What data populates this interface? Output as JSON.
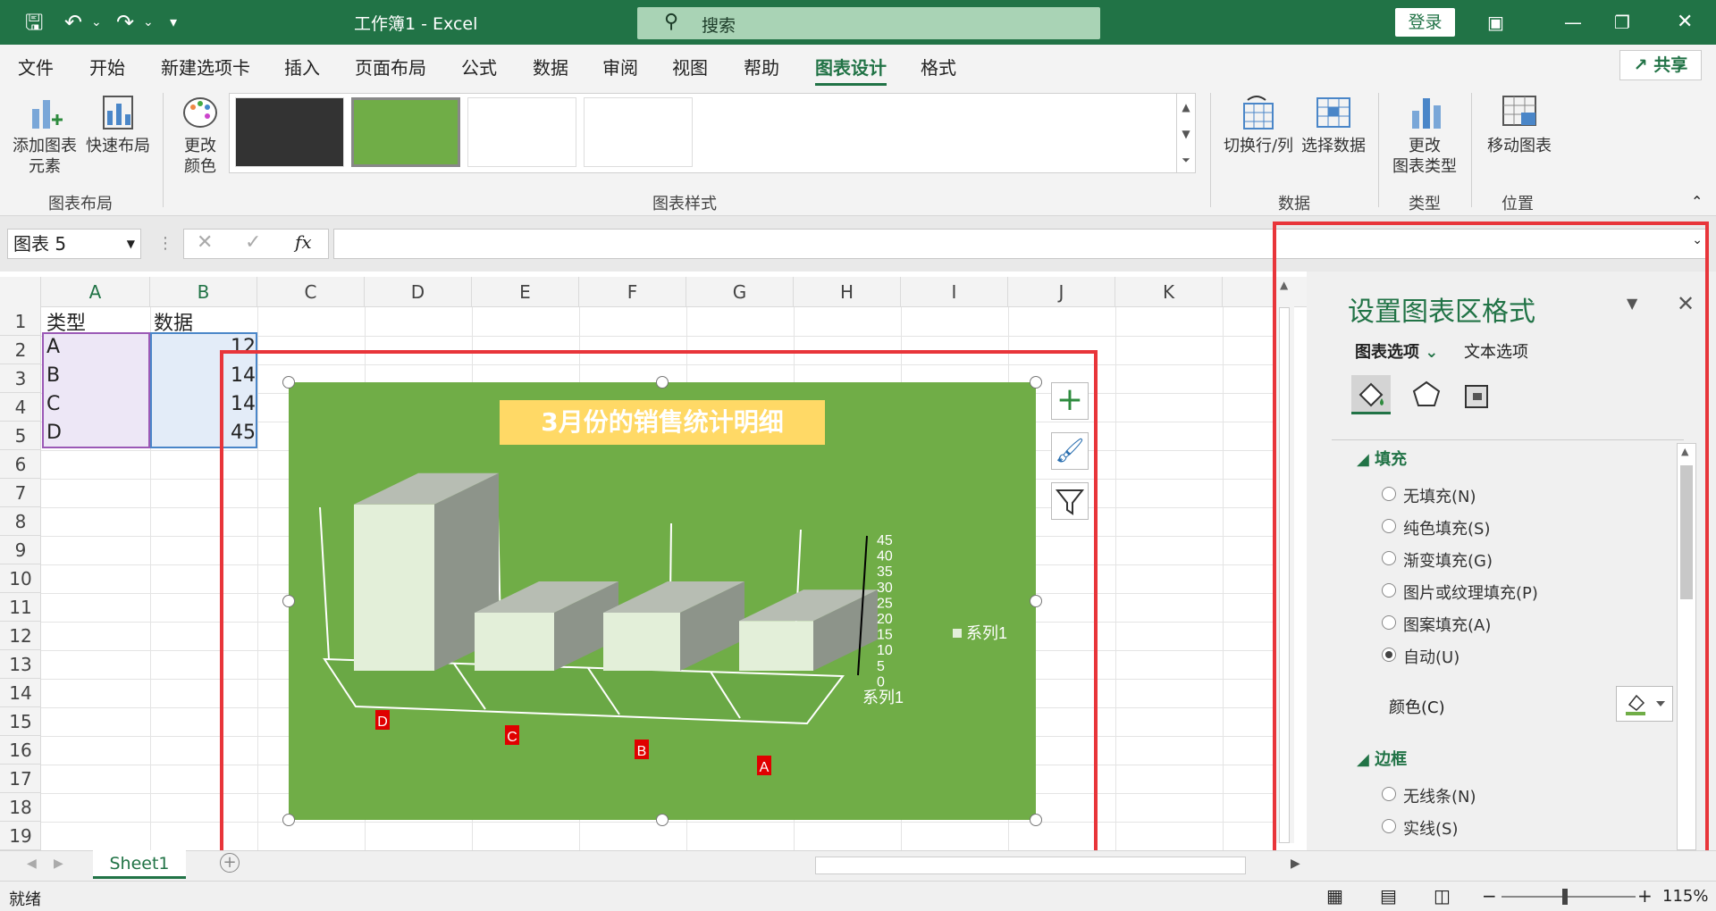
{
  "titlebar": {
    "workbook": "工作簿1  -  Excel",
    "search_placeholder": "搜索",
    "login": "登录"
  },
  "menu": {
    "tabs": [
      "文件",
      "开始",
      "新建选项卡",
      "插入",
      "页面布局",
      "公式",
      "数据",
      "审阅",
      "视图",
      "帮助",
      "图表设计",
      "格式"
    ],
    "active": "图表设计",
    "share": "共享"
  },
  "ribbon": {
    "add_element": "添加图表\n元素",
    "quick_layout": "快速布局",
    "change_colors": "更改\n颜色",
    "group_layout": "图表布局",
    "group_styles": "图表样式",
    "switch_rowcol": "切换行/列",
    "select_data": "选择数据",
    "group_data": "数据",
    "change_type": "更改\n图表类型",
    "group_type": "类型",
    "move_chart": "移动图表",
    "group_position": "位置"
  },
  "formula": {
    "namebox": "图表 5",
    "fx": "fx"
  },
  "grid": {
    "columns": [
      "A",
      "B",
      "C",
      "D",
      "E",
      "F",
      "G",
      "H",
      "I",
      "J",
      "K"
    ],
    "rows": [
      "1",
      "2",
      "3",
      "4",
      "5",
      "6",
      "7",
      "8",
      "9",
      "10",
      "11",
      "12",
      "13",
      "14",
      "15",
      "16",
      "17",
      "18",
      "19"
    ],
    "cells": [
      [
        "类型",
        "数据"
      ],
      [
        "A",
        "12"
      ],
      [
        "B",
        "14"
      ],
      [
        "C",
        "14"
      ],
      [
        "D",
        "45"
      ]
    ]
  },
  "chart_data": {
    "type": "bar",
    "title": "3月份的销售统计明细",
    "categories": [
      "D",
      "C",
      "B",
      "A"
    ],
    "series": [
      {
        "name": "系列1",
        "values": [
          45,
          14,
          14,
          12
        ]
      }
    ],
    "y_ticks": [
      "45",
      "40",
      "35",
      "30",
      "25",
      "20",
      "15",
      "10",
      "5",
      "0"
    ],
    "depth_label": "系列1",
    "legend": "系列1",
    "ylim": [
      0,
      45
    ],
    "colors": {
      "bg": "#70ad47",
      "bar_front": "#e3efd9",
      "bar_side": "#8d948a",
      "bar_top": "#b7bdb3",
      "title_bg": "#ffd966",
      "label_bg": "#e00000"
    }
  },
  "pane": {
    "title": "设置图表区格式",
    "tab1": "图表选项",
    "tab2": "文本选项",
    "fill_header": "填充",
    "options": [
      "无填充(N)",
      "纯色填充(S)",
      "渐变填充(G)",
      "图片或纹理填充(P)",
      "图案填充(A)",
      "自动(U)"
    ],
    "selected": "自动(U)",
    "color_label": "颜色(C)",
    "border_header": "边框",
    "border_options": [
      "无线条(N)",
      "实线(S)"
    ]
  },
  "sheet": {
    "tab": "Sheet1"
  },
  "status": {
    "ready": "就绪",
    "zoom": "115%"
  }
}
